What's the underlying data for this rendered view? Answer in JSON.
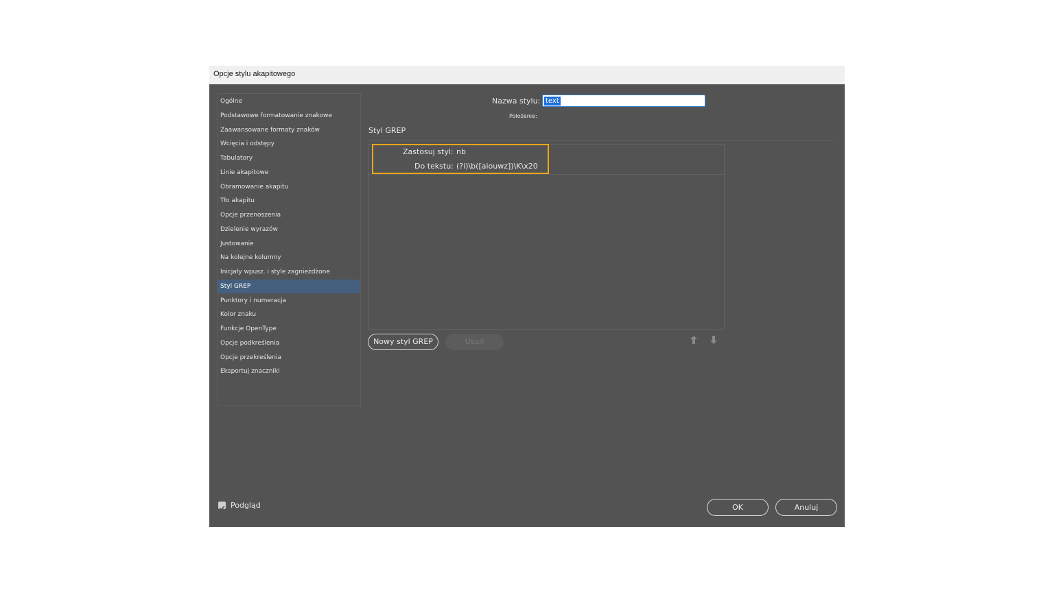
{
  "window": {
    "title": "Opcje stylu akapitowego"
  },
  "sidebar": {
    "items": [
      "Ogólne",
      "Podstawowe formatowanie znakowe",
      "Zaawansowane formaty znaków",
      "Wcięcia i odstępy",
      "Tabulatory",
      "Linie akapitowe",
      "Obramowanie akapitu",
      "Tło akapitu",
      "Opcje przenoszenia",
      "Dzielenie wyrazów",
      "Justowanie",
      "Na kolejne kolumny",
      "Inicjały wpusz. i style zagnieżdżone",
      "Styl GREP",
      "Punktory i numeracja",
      "Kolor znaku",
      "Funkcje OpenType",
      "Opcje podkreślenia",
      "Opcje przekreślenia",
      "Eksportuj znaczniki"
    ],
    "active_index": 13
  },
  "form": {
    "style_name_label": "Nazwa stylu:",
    "style_name_value": "text",
    "location_label": "Położenie:"
  },
  "section": {
    "title": "Styl GREP"
  },
  "grep_rule": {
    "apply_style_label": "Zastosuj styl:",
    "apply_style_value": "nb",
    "to_text_label": "Do tekstu:",
    "to_text_value": "(?i)\\b([aiouwz])\\K\\x20"
  },
  "buttons": {
    "new_grep_style": "Nowy styl GREP",
    "delete": "Usuń",
    "ok": "OK",
    "cancel": "Anuluj"
  },
  "preview": {
    "label": "Podgląd",
    "checked": true
  },
  "icons": {
    "move_up": "arrow-up-icon",
    "move_down": "arrow-down-icon",
    "checkbox": "checkmark-icon"
  },
  "colors": {
    "dialog_bg": "#535353",
    "selection": "#45607f",
    "highlight_border": "#f2a71b"
  }
}
